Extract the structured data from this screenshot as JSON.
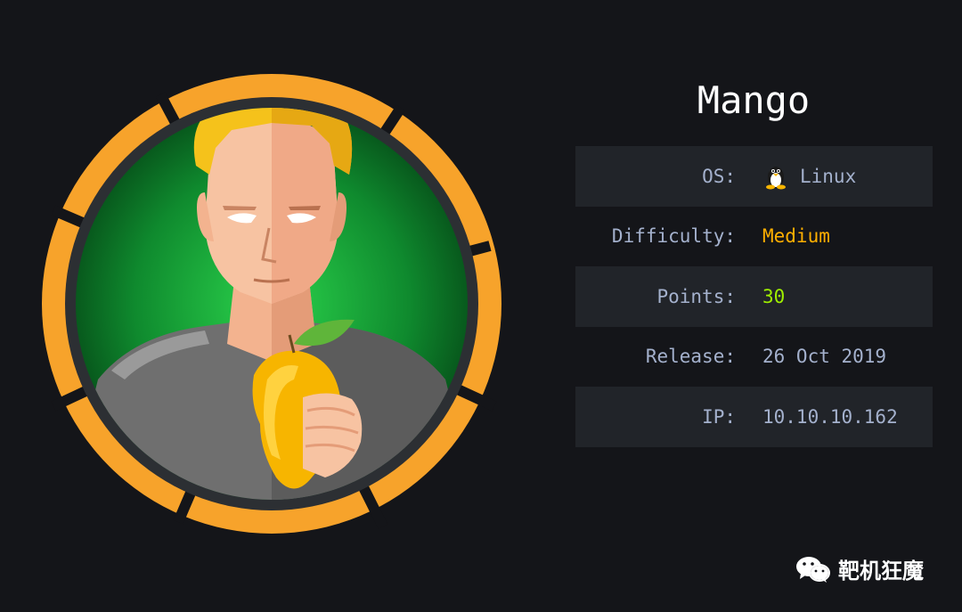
{
  "machine": {
    "name": "Mango",
    "avatar_icon": "mango-character-avatar",
    "ring_color": "#f7a32b"
  },
  "info": {
    "os": {
      "label": "OS:",
      "value": "Linux",
      "icon": "tux-icon"
    },
    "difficulty": {
      "label": "Difficulty:",
      "value": "Medium",
      "color": "#ffaf00"
    },
    "points": {
      "label": "Points:",
      "value": "30",
      "color": "#9fef00"
    },
    "release": {
      "label": "Release:",
      "value": "26 Oct 2019"
    },
    "ip": {
      "label": "IP:",
      "value": "10.10.10.162"
    }
  },
  "watermark": {
    "icon": "wechat-icon",
    "text": "靶机狂魔"
  }
}
